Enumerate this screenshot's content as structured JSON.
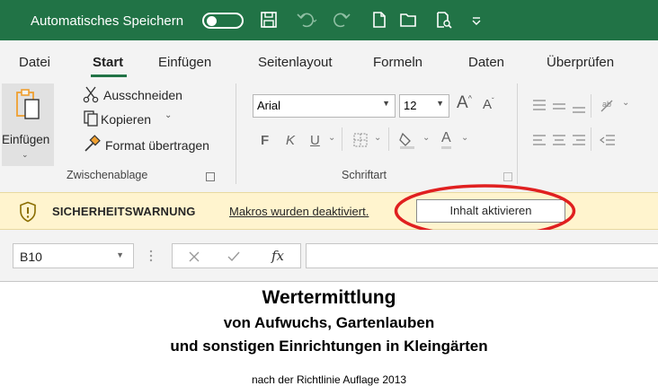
{
  "titlebar": {
    "autosave_label": "Automatisches Speichern",
    "autosave_state": "off"
  },
  "menu": {
    "tabs": [
      "Datei",
      "Start",
      "Einfügen",
      "Seitenlayout",
      "Formeln",
      "Daten",
      "Überprüfen"
    ],
    "active_tab": "Start"
  },
  "ribbon": {
    "clipboard": {
      "paste_label": "Einfügen",
      "cut_label": "Ausschneiden",
      "copy_label": "Kopieren",
      "format_painter_label": "Format übertragen",
      "group_label": "Zwischenablage"
    },
    "font": {
      "font_name": "Arial",
      "font_size": "12",
      "bold_label": "F",
      "italic_label": "K",
      "underline_label": "U",
      "group_label": "Schriftart"
    }
  },
  "security_bar": {
    "title": "SICHERHEITSWARNUNG",
    "message": "Makros wurden deaktiviert.",
    "button_label": "Inhalt aktivieren"
  },
  "formula_bar": {
    "name_box": "B10",
    "fx_label": "fx",
    "formula": ""
  },
  "sheet": {
    "line1": "Wertermittlung",
    "line2": "von Aufwuchs, Gartenlauben",
    "line3": "und sonstigen Einrichtungen in Kleingärten",
    "line4": "nach der Richtlinie Auflage 2013"
  },
  "colors": {
    "accent": "#217346",
    "warning_bg": "#fff4ce",
    "annotation": "#e02020"
  }
}
